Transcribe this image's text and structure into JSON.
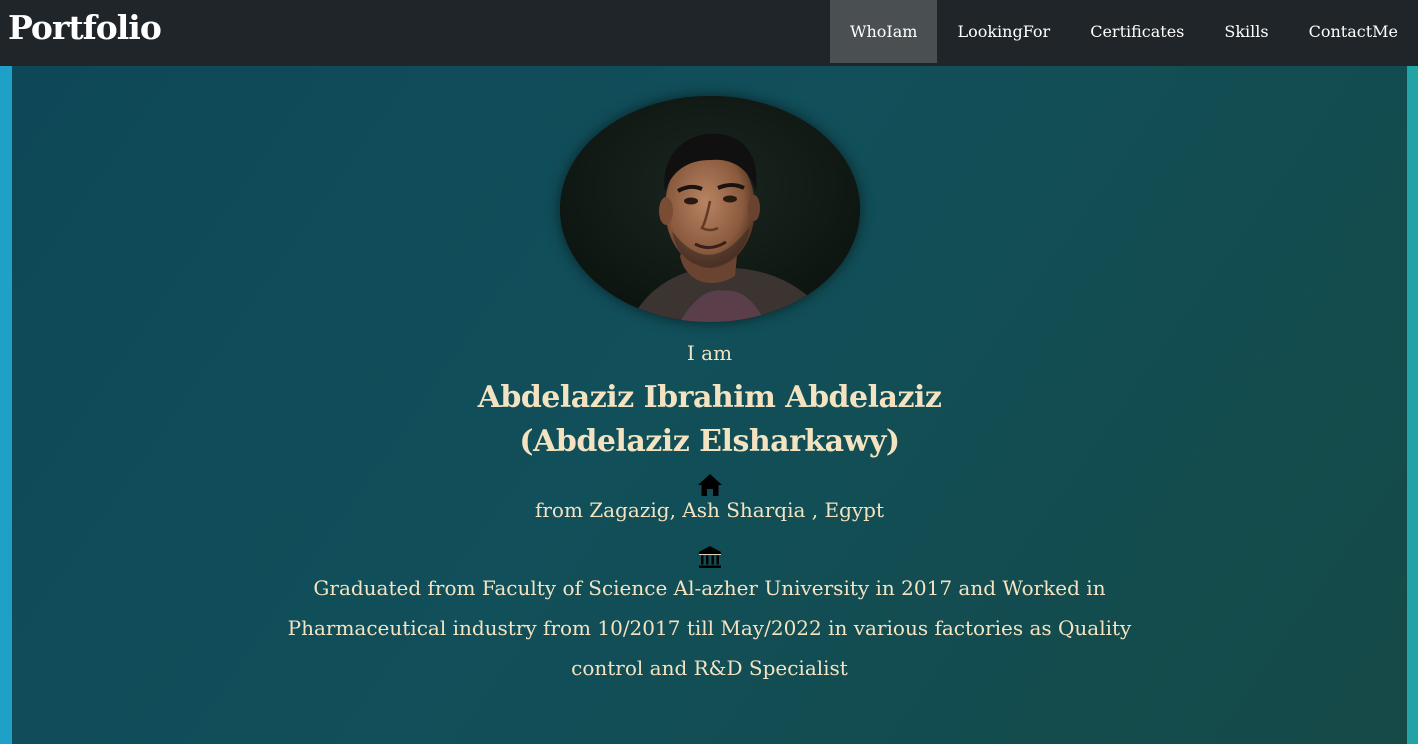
{
  "navbar": {
    "brand": "Portfolio",
    "items": [
      {
        "label": "WhoIam",
        "active": true
      },
      {
        "label": "LookingFor",
        "active": false
      },
      {
        "label": "Certificates",
        "active": false
      },
      {
        "label": "Skills",
        "active": false
      },
      {
        "label": "ContactMe",
        "active": false
      }
    ]
  },
  "profile": {
    "intro": "I am",
    "name_line1": "Abdelaziz Ibrahim Abdelaziz",
    "name_line2": "(Abdelaziz Elsharkawy)",
    "home_icon": "home-icon",
    "location": "from Zagazig, Ash Sharqia , Egypt",
    "university_icon": "university-icon",
    "bio": "Graduated from Faculty of Science Al-azher University in 2017 and Worked in Pharmaceutical industry from 10/2017 till May/2022 in various factories as Quality control and R&D Specialist"
  },
  "colors": {
    "navbar_bg": "#1f2528",
    "nav_active_bg": "#4a4f52",
    "text_accent": "#f4e3c0",
    "page_bg": "#0e4858"
  }
}
